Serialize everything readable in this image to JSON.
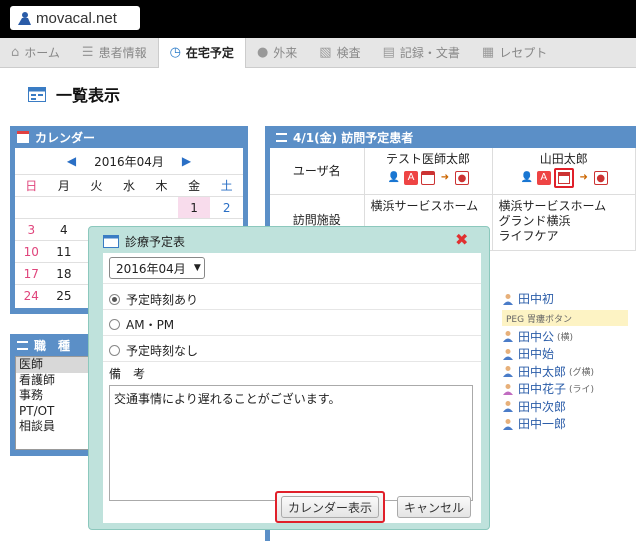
{
  "app": {
    "logo": "movacal.net"
  },
  "nav": [
    {
      "label": "ホーム",
      "icon": "home-icon"
    },
    {
      "label": "患者情報",
      "icon": "patients-icon"
    },
    {
      "label": "在宅予定",
      "icon": "clock-icon"
    },
    {
      "label": "外来",
      "icon": "person-icon"
    },
    {
      "label": "検査",
      "icon": "chart-icon"
    },
    {
      "label": "記録・文書",
      "icon": "document-icon"
    },
    {
      "label": "レセプト",
      "icon": "receipt-icon"
    }
  ],
  "page": {
    "title": "一覧表示"
  },
  "calendar": {
    "header": "カレンダー",
    "month": "2016年04月",
    "weekdays": [
      "日",
      "月",
      "火",
      "水",
      "木",
      "金",
      "土"
    ],
    "rows": [
      [
        "",
        "",
        "",
        "",
        "",
        "1",
        "2"
      ],
      [
        "3",
        "4",
        "",
        "",
        "",
        "",
        ""
      ],
      [
        "10",
        "11",
        "",
        "",
        "",
        "",
        ""
      ],
      [
        "17",
        "18",
        "",
        "",
        "",
        "",
        ""
      ],
      [
        "24",
        "25",
        "",
        "",
        "",
        "",
        ""
      ]
    ]
  },
  "jobs": {
    "header": "職　種",
    "items": [
      "医師",
      "看護師",
      "事務",
      "PT/OT",
      "相談員"
    ],
    "selected": "医師"
  },
  "visit": {
    "header": "4/1(金) 訪問予定患者",
    "user_label": "ユーザ名",
    "facility_label": "訪問施設",
    "doctors": [
      {
        "name": "テスト医師太郎",
        "facilities": [
          "横浜サービスホーム"
        ]
      },
      {
        "name": "山田太郎",
        "facilities": [
          "横浜サービスホーム",
          "グランド横浜",
          "ライフケア"
        ]
      }
    ],
    "peg": "PEG 胃瘻ボタン",
    "patients": [
      {
        "name": "田中初",
        "note": ""
      },
      {
        "name": "田中公",
        "note": "(横)"
      },
      {
        "name": "田中始",
        "note": ""
      },
      {
        "name": "田中太郎",
        "note": "(グ横)"
      },
      {
        "name": "田中花子",
        "note": "(ライ)"
      },
      {
        "name": "田中次郎",
        "note": ""
      },
      {
        "name": "田中一郎",
        "note": ""
      }
    ]
  },
  "dialog": {
    "title": "診療予定表",
    "month": "2016年04月",
    "options": [
      "予定時刻あり",
      "AM・PM",
      "予定時刻なし"
    ],
    "selected_option": "予定時刻あり",
    "remark_label": "備　考",
    "remark": "交通事情により遅れることがございます。",
    "calendar_button": "カレンダー表示",
    "cancel_button": "キャンセル"
  },
  "colors": {
    "panel": "#5b8fc7",
    "dialog": "#bfe2dc",
    "highlight": "#e0202a"
  }
}
